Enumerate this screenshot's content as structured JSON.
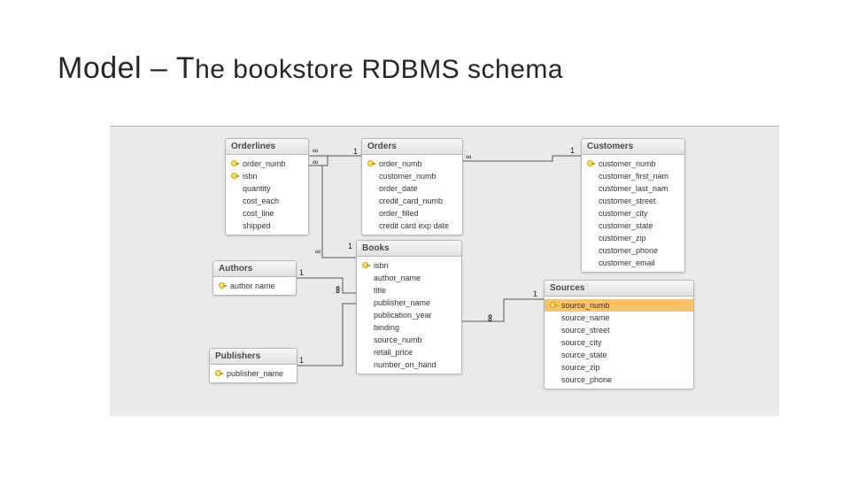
{
  "title_part1": "Model – T",
  "title_part2": "he bookstore RDBMS schema",
  "tables": {
    "orderlines": {
      "name": "Orderlines",
      "fields": [
        {
          "key": true,
          "label": "order_numb"
        },
        {
          "key": true,
          "label": "isbn"
        },
        {
          "key": false,
          "label": "quantity"
        },
        {
          "key": false,
          "label": "cost_each"
        },
        {
          "key": false,
          "label": "cost_line"
        },
        {
          "key": false,
          "label": "shipped"
        }
      ]
    },
    "orders": {
      "name": "Orders",
      "fields": [
        {
          "key": true,
          "label": "order_numb"
        },
        {
          "key": false,
          "label": "customer_numb"
        },
        {
          "key": false,
          "label": "order_date"
        },
        {
          "key": false,
          "label": "credit_card_numb"
        },
        {
          "key": false,
          "label": "order_filled"
        },
        {
          "key": false,
          "label": "credit card exp date"
        }
      ]
    },
    "customers": {
      "name": "Customers",
      "fields": [
        {
          "key": true,
          "label": "customer_numb"
        },
        {
          "key": false,
          "label": "customer_first_nam"
        },
        {
          "key": false,
          "label": "customer_last_nam"
        },
        {
          "key": false,
          "label": "customer_street"
        },
        {
          "key": false,
          "label": "customer_city"
        },
        {
          "key": false,
          "label": "customer_state"
        },
        {
          "key": false,
          "label": "customer_zip"
        },
        {
          "key": false,
          "label": "customer_phone"
        },
        {
          "key": false,
          "label": "customer_email"
        }
      ]
    },
    "authors": {
      "name": "Authors",
      "fields": [
        {
          "key": true,
          "label": "author name"
        }
      ]
    },
    "books": {
      "name": "Books",
      "fields": [
        {
          "key": true,
          "label": "isbn"
        },
        {
          "key": false,
          "label": "author_name"
        },
        {
          "key": false,
          "label": "title"
        },
        {
          "key": false,
          "label": "publisher_name"
        },
        {
          "key": false,
          "label": "publication_year"
        },
        {
          "key": false,
          "label": "binding"
        },
        {
          "key": false,
          "label": "source_numb"
        },
        {
          "key": false,
          "label": "retail_price"
        },
        {
          "key": false,
          "label": "number_on_hand"
        }
      ]
    },
    "sources": {
      "name": "Sources",
      "fields": [
        {
          "key": true,
          "label": "source_numb",
          "selected": true
        },
        {
          "key": false,
          "label": "source_name"
        },
        {
          "key": false,
          "label": "source_street"
        },
        {
          "key": false,
          "label": "source_city"
        },
        {
          "key": false,
          "label": "source_state"
        },
        {
          "key": false,
          "label": "source_zip"
        },
        {
          "key": false,
          "label": "source_phone"
        }
      ]
    },
    "publishers": {
      "name": "Publishers",
      "fields": [
        {
          "key": true,
          "label": "publisher_name"
        }
      ]
    }
  },
  "relationships": [
    {
      "from": "Orderlines",
      "to": "Orders",
      "card_from": "∞",
      "card_to": "1"
    },
    {
      "from": "Orders",
      "to": "Customers",
      "card_from": "∞",
      "card_to": "1"
    },
    {
      "from": "Orderlines",
      "to": "Books",
      "card_from": "∞",
      "card_to": "1"
    },
    {
      "from": "Authors",
      "to": "Books",
      "card_from": "1",
      "card_to": "∞"
    },
    {
      "from": "Publishers",
      "to": "Books",
      "card_from": "1",
      "card_to": "∞"
    },
    {
      "from": "Books",
      "to": "Sources",
      "card_from": "∞",
      "card_to": "1"
    }
  ],
  "cardinality": {
    "one": "1",
    "many": "∞"
  }
}
